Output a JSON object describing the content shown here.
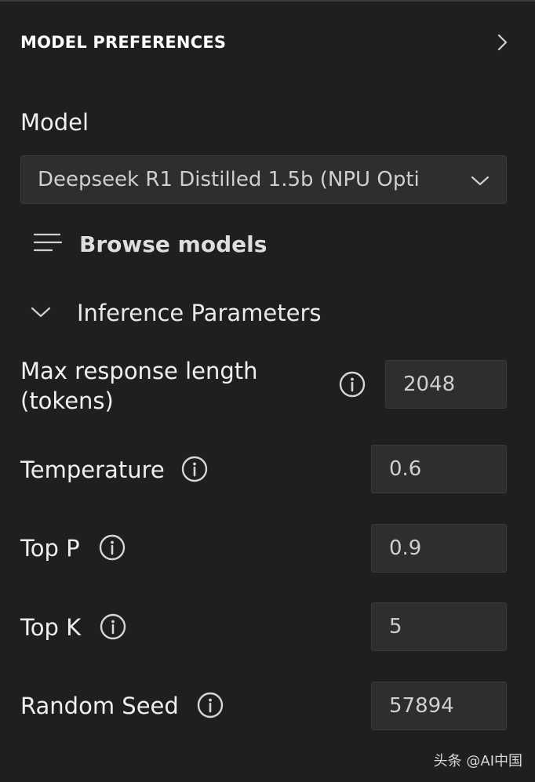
{
  "header": {
    "title": "MODEL PREFERENCES",
    "collapse_icon": "chevron-right-icon"
  },
  "model": {
    "label": "Model",
    "selected": "Deepseek R1 Distilled 1.5b (NPU Opti",
    "dropdown_icon": "chevron-down-icon"
  },
  "browse": {
    "label": "Browse models",
    "icon": "list-icon"
  },
  "inference": {
    "label": "Inference Parameters",
    "expanded": true,
    "params": [
      {
        "label_line1": "Max response length",
        "label_line2": "(tokens)",
        "value": "2048"
      },
      {
        "label": "Temperature",
        "value": "0.6"
      },
      {
        "label": "Top P",
        "value": "0.9"
      },
      {
        "label": "Top K",
        "value": "5"
      },
      {
        "label": "Random Seed",
        "value": "57894"
      }
    ]
  },
  "watermark": "头条 @AI中国",
  "colors": {
    "background": "#1f1f1f",
    "field_background": "#2e2e2e",
    "field_border": "#3b3b3b",
    "text": "#f0f0f0"
  }
}
